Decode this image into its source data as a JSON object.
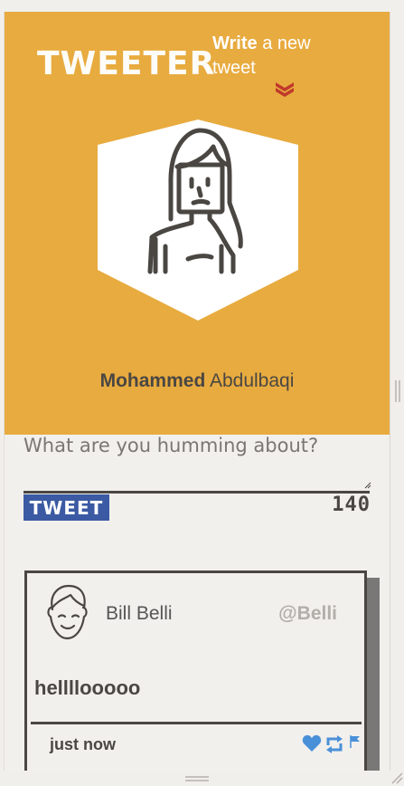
{
  "header": {
    "logo": "TWEETER",
    "write_strong": "Write",
    "write_rest": " a new tweet",
    "chevron_icon": "double-chevron-down-icon"
  },
  "profile": {
    "first_name": "Mohammed",
    "last_name": "Abdulbaqi",
    "avatar_icon": "woman-avatar-icon"
  },
  "composer": {
    "placeholder": "What are you humming about?",
    "value": "",
    "button_label": "TWEET",
    "char_count": "140"
  },
  "tweets": [
    {
      "name": "Bill Belli",
      "handle": "@Belli",
      "text": "hellllooooo",
      "time": "just now",
      "avatar_icon": "man-avatar-icon",
      "actions": [
        "heart-icon",
        "retweet-icon",
        "flag-icon"
      ]
    }
  ],
  "colors": {
    "hero_bg": "#e8ab3f",
    "dark": "#4a4743",
    "tweet_button": "#3b5aa3",
    "chevron": "#c0392b",
    "action_blue": "#4a90d9"
  }
}
